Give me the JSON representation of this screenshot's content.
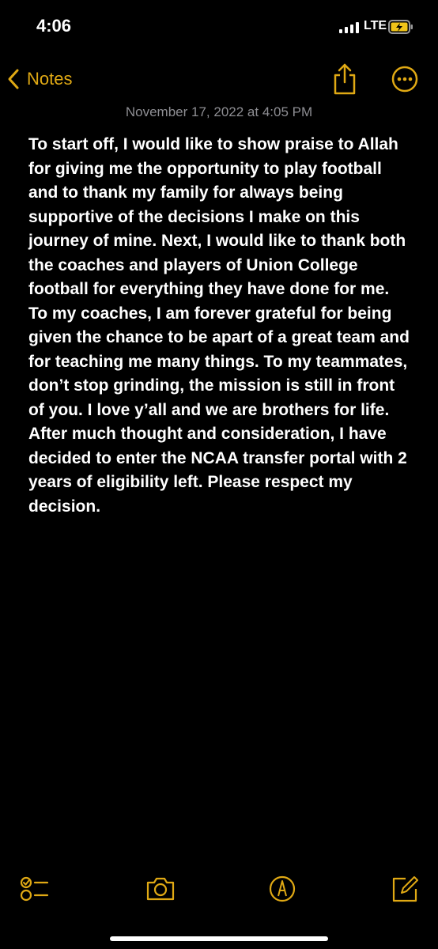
{
  "status_bar": {
    "time": "4:06",
    "network": "LTE",
    "charging": true
  },
  "nav": {
    "back_label": "Notes",
    "accent_color": "#e0a914",
    "icons": [
      "chevron-left-icon",
      "share-icon",
      "more-icon"
    ]
  },
  "note": {
    "date": "November 17, 2022 at 4:05 PM",
    "body": "To start off, I would like to show praise to Allah for giving me the opportunity to play football and to thank my family for always being supportive of the decisions I make on this journey of mine. Next, I would like to thank both the coaches and players of Union College football for everything they have done for me. To my coaches, I am forever grateful for being given the chance to be apart of a great team and for teaching me many things. To my teammates, don’t stop grinding, the mission is still in front of you. I love y’all and we are brothers for life. After much thought and consideration, I have decided to enter the NCAA transfer portal with 2 years of eligibility left. Please respect my decision."
  },
  "toolbar": {
    "icons": [
      "checklist-icon",
      "camera-icon",
      "markup-icon",
      "compose-icon"
    ]
  }
}
